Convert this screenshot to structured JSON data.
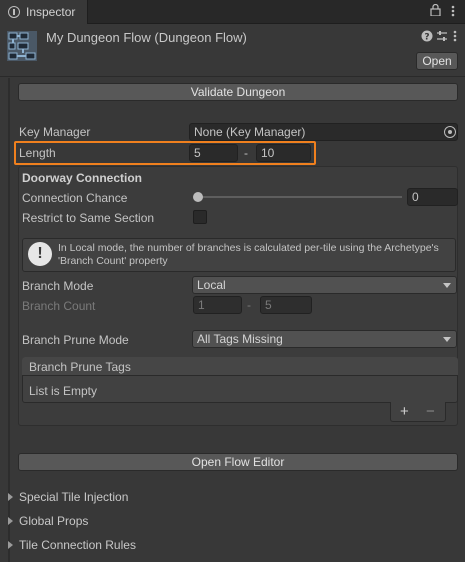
{
  "tab": {
    "label": "Inspector"
  },
  "header": {
    "title": "My Dungeon Flow (Dungeon Flow)",
    "open_label": "Open"
  },
  "validate_label": "Validate Dungeon",
  "key_manager": {
    "label": "Key Manager",
    "value": "None (Key Manager)"
  },
  "length": {
    "label": "Length",
    "min": "5",
    "separator": "-",
    "max": "10"
  },
  "doorway": {
    "heading": "Doorway Connection",
    "chance_label": "Connection Chance",
    "chance_value": "0",
    "chance_fraction": 0,
    "restrict_label": "Restrict to Same Section",
    "restrict_checked": false
  },
  "help": {
    "text": "In Local mode, the number of branches is calculated per-tile using the Archetype's 'Branch Count' property"
  },
  "branch": {
    "mode_label": "Branch Mode",
    "mode_value": "Local",
    "count_label": "Branch Count",
    "count_min": "1",
    "count_separator": "-",
    "count_max": "5",
    "prune_label": "Branch Prune Mode",
    "prune_value": "All Tags Missing",
    "tags_header": "Branch Prune Tags",
    "tags_empty": "List is Empty",
    "add_label": "+",
    "remove_label": "−"
  },
  "open_flow_label": "Open Flow Editor",
  "foldouts": [
    {
      "label": "Special Tile Injection"
    },
    {
      "label": "Global Props"
    },
    {
      "label": "Tile Connection Rules"
    }
  ],
  "colors": {
    "highlight": "#f0801e",
    "background": "#383838"
  },
  "icons": {
    "tab": "info-icon",
    "lock": "lock-icon",
    "menu": "kebab-menu-icon",
    "help": "help-icon",
    "presets": "sliders-icon",
    "more": "more-icon",
    "object_picker": "target-icon",
    "warning": "exclamation-icon",
    "object": "dungeon-flow-icon"
  }
}
